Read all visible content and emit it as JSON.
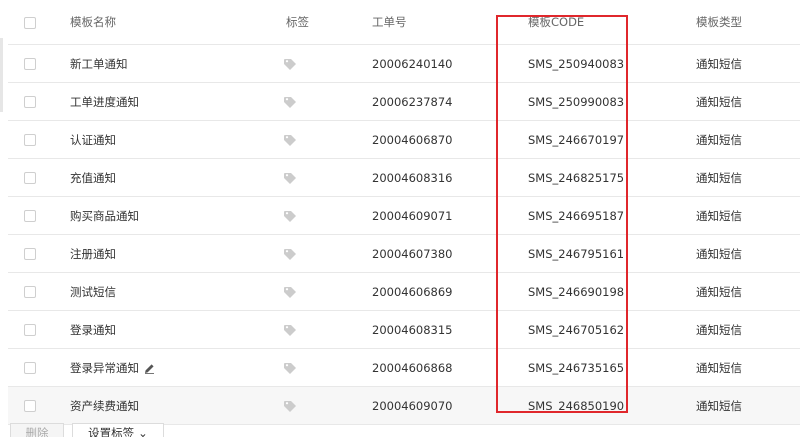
{
  "table": {
    "columns": {
      "name": "模板名称",
      "tag": "标签",
      "ticket": "工单号",
      "code": "模板CODE",
      "type": "模板类型"
    },
    "rows": [
      {
        "name": "新工单通知",
        "ticket": "20006240140",
        "code": "SMS_250940083",
        "type": "通知短信"
      },
      {
        "name": "工单进度通知",
        "ticket": "20006237874",
        "code": "SMS_250990083",
        "type": "通知短信"
      },
      {
        "name": "认证通知",
        "ticket": "20004606870",
        "code": "SMS_246670197",
        "type": "通知短信"
      },
      {
        "name": "充值通知",
        "ticket": "20004608316",
        "code": "SMS_246825175",
        "type": "通知短信"
      },
      {
        "name": "购买商品通知",
        "ticket": "20004609071",
        "code": "SMS_246695187",
        "type": "通知短信"
      },
      {
        "name": "注册通知",
        "ticket": "20004607380",
        "code": "SMS_246795161",
        "type": "通知短信"
      },
      {
        "name": "测试短信",
        "ticket": "20004606869",
        "code": "SMS_246690198",
        "type": "通知短信"
      },
      {
        "name": "登录通知",
        "ticket": "20004608315",
        "code": "SMS_246705162",
        "type": "通知短信"
      },
      {
        "name": "登录异常通知",
        "ticket": "20004606868",
        "code": "SMS_246735165",
        "type": "通知短信"
      },
      {
        "name": "资产续费通知",
        "ticket": "20004609070",
        "code": "SMS_246850190",
        "type": "通知短信"
      }
    ]
  },
  "footer": {
    "delete_label": "删除",
    "set_tag_label": "设置标签"
  },
  "icons": {
    "tag": "tag-icon",
    "edit": "edit-icon",
    "chevron": "chevron-down-icon"
  },
  "colors": {
    "highlight_box": "#e0272c",
    "tag_icon": "#cccccc",
    "row_shade": "#f7f7f7"
  }
}
